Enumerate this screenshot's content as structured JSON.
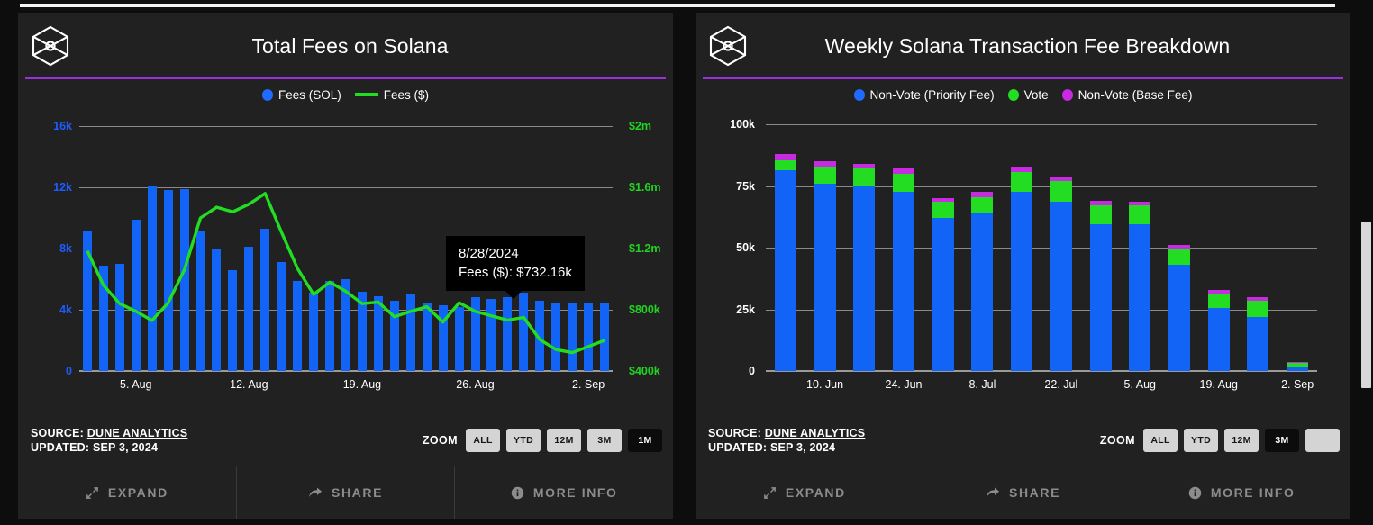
{
  "left_panel": {
    "logo_icon": "dune-cube-icon",
    "title": "Total Fees on Solana",
    "legend": [
      {
        "label": "Fees (SOL)",
        "marker": "dot",
        "color": "#1f6bff"
      },
      {
        "label": "Fees ($)",
        "marker": "line",
        "color": "#22dd22"
      }
    ],
    "tooltip": {
      "date": "8/28/2024",
      "line": "Fees ($): $732.16k"
    },
    "source_label": "SOURCE:",
    "source_name": "DUNE ANALYTICS",
    "updated_label": "UPDATED:",
    "updated_value": "SEP 3, 2024",
    "zoom_label": "ZOOM",
    "zoom_buttons": [
      {
        "label": "ALL",
        "active": false
      },
      {
        "label": "YTD",
        "active": false
      },
      {
        "label": "12M",
        "active": false
      },
      {
        "label": "3M",
        "active": false
      },
      {
        "label": "1M",
        "active": true
      }
    ],
    "actions": [
      {
        "label": "EXPAND",
        "icon": "expand-icon"
      },
      {
        "label": "SHARE",
        "icon": "share-icon"
      },
      {
        "label": "MORE INFO",
        "icon": "info-icon"
      }
    ]
  },
  "right_panel": {
    "logo_icon": "dune-cube-icon",
    "title": "Weekly Solana Transaction Fee Breakdown",
    "legend": [
      {
        "label": "Non-Vote (Priority Fee)",
        "marker": "dot",
        "color": "#1f6bff"
      },
      {
        "label": "Vote",
        "marker": "dot",
        "color": "#22dd22"
      },
      {
        "label": "Non-Vote (Base Fee)",
        "marker": "dot",
        "color": "#c72ae0"
      }
    ],
    "source_label": "SOURCE:",
    "source_name": "DUNE ANALYTICS",
    "updated_label": "UPDATED:",
    "updated_value": "SEP 3, 2024",
    "zoom_label": "ZOOM",
    "zoom_buttons": [
      {
        "label": "ALL",
        "active": false
      },
      {
        "label": "YTD",
        "active": false
      },
      {
        "label": "12M",
        "active": false
      },
      {
        "label": "3M",
        "active": true
      },
      {
        "label": "",
        "active": false
      }
    ],
    "actions": [
      {
        "label": "EXPAND",
        "icon": "expand-icon"
      },
      {
        "label": "SHARE",
        "icon": "share-icon"
      },
      {
        "label": "MORE INFO",
        "icon": "info-icon"
      }
    ]
  },
  "chart_data": [
    {
      "type": "bar",
      "title": "Total Fees on Solana",
      "xlabel": "",
      "ylabel": "Fees (SOL)",
      "y2label": "Fees ($)",
      "grid": true,
      "legend_position": "top-center",
      "ylim": [
        0,
        16000
      ],
      "y2lim": [
        400000,
        2000000
      ],
      "yticks": [
        "0",
        "4k",
        "8k",
        "12k",
        "16k"
      ],
      "ytick_values": [
        0,
        4000,
        8000,
        12000,
        16000
      ],
      "y2ticks": [
        "$400k",
        "$800k",
        "$1.2m",
        "$1.6m",
        "$2m"
      ],
      "y2tick_values": [
        400000,
        800000,
        1200000,
        1600000,
        2000000
      ],
      "xticks": [
        "5. Aug",
        "12. Aug",
        "19. Aug",
        "26. Aug",
        "2. Sep"
      ],
      "x": [
        "8/2",
        "8/3",
        "8/4",
        "8/5",
        "8/6",
        "8/7",
        "8/8",
        "8/9",
        "8/10",
        "8/11",
        "8/12",
        "8/13",
        "8/14",
        "8/15",
        "8/16",
        "8/17",
        "8/18",
        "8/19",
        "8/20",
        "8/21",
        "8/22",
        "8/23",
        "8/24",
        "8/25",
        "8/26",
        "8/27",
        "8/28",
        "8/29",
        "8/30",
        "8/31",
        "9/1",
        "9/2",
        "9/3"
      ],
      "series": [
        {
          "name": "Fees (SOL)",
          "type": "bar",
          "color": "#1164f5",
          "axis": "left",
          "values": [
            9200,
            6900,
            7000,
            9900,
            12100,
            11800,
            11900,
            9200,
            8000,
            6600,
            8100,
            9300,
            7100,
            5900,
            5100,
            5900,
            6000,
            5200,
            4900,
            4600,
            5000,
            4400,
            4300,
            4200,
            4800,
            4700,
            4800,
            5100,
            4600,
            4400,
            4400,
            4400,
            4400
          ]
        },
        {
          "name": "Fees ($)",
          "type": "line",
          "color": "#22dd22",
          "axis": "right",
          "values": [
            1185000,
            960000,
            840000,
            790000,
            730000,
            845000,
            1060000,
            1400000,
            1470000,
            1440000,
            1490000,
            1560000,
            1310000,
            1070000,
            900000,
            980000,
            920000,
            840000,
            850000,
            755000,
            790000,
            820000,
            720000,
            845000,
            790000,
            760000,
            732160,
            750000,
            605000,
            540000,
            520000,
            560000,
            600000
          ]
        }
      ],
      "tooltip": {
        "date": "8/28/2024",
        "series": "Fees ($)",
        "value": "$732.16k"
      }
    },
    {
      "type": "bar",
      "stacked": true,
      "title": "Weekly Solana Transaction Fee Breakdown",
      "xlabel": "",
      "ylabel": "",
      "grid": true,
      "legend_position": "top-center",
      "ylim": [
        0,
        100000
      ],
      "yticks": [
        "0",
        "25k",
        "50k",
        "75k",
        "100k"
      ],
      "ytick_values": [
        0,
        25000,
        50000,
        75000,
        100000
      ],
      "xticks": [
        "10. Jun",
        "24. Jun",
        "8. Jul",
        "22. Jul",
        "5. Aug",
        "19. Aug",
        "2. Sep"
      ],
      "categories": [
        "3. Jun",
        "10. Jun",
        "17. Jun",
        "24. Jun",
        "1. Jul",
        "8. Jul",
        "15. Jul",
        "22. Jul",
        "29. Jul",
        "5. Aug",
        "12. Aug",
        "19. Aug",
        "26. Aug",
        "2. Sep"
      ],
      "series": [
        {
          "name": "Non-Vote (Priority Fee)",
          "color": "#1164f5",
          "values": [
            81500,
            76000,
            75000,
            72500,
            62000,
            64000,
            72500,
            68500,
            59500,
            59500,
            43000,
            25500,
            22000,
            2000
          ]
        },
        {
          "name": "Vote",
          "color": "#22dd22",
          "values": [
            4000,
            6500,
            7000,
            7500,
            6500,
            6500,
            8000,
            8500,
            7500,
            7500,
            6500,
            6000,
            6500,
            1500
          ]
        },
        {
          "name": "Non-Vote (Base Fee)",
          "color": "#c72ae0",
          "values": [
            2500,
            2500,
            2000,
            2000,
            1500,
            2000,
            2000,
            2000,
            2000,
            1500,
            1500,
            1500,
            1500,
            300
          ]
        }
      ]
    }
  ]
}
